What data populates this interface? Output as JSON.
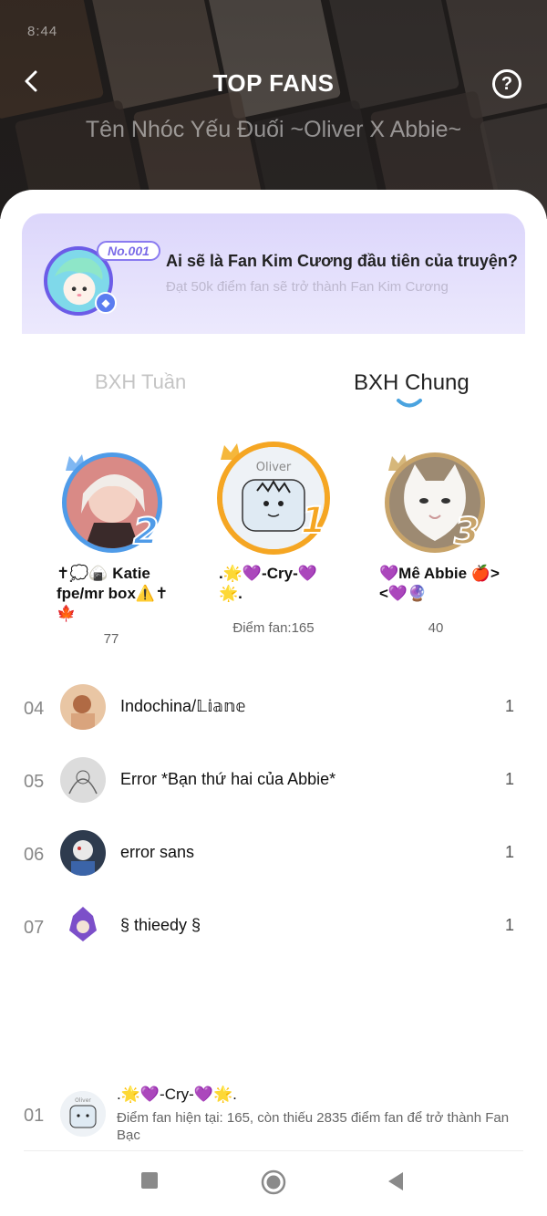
{
  "status_bar": {
    "time": "8:44",
    "right_text": ""
  },
  "header": {
    "title": "TOP FANS",
    "story_title": "Tên Nhóc Yếu Đuối ~Oliver X Abbie~"
  },
  "banner": {
    "badge": "No.001",
    "question": "Ai sẽ là Fan Kim Cương đầu tiên của truyện?",
    "subtitle": "Đạt 50k điểm fan sẽ trở thành Fan Kim Cương"
  },
  "tabs": [
    {
      "label": "BXH Tuần",
      "active": false
    },
    {
      "label": "BXH Chung",
      "active": true
    }
  ],
  "podium": [
    {
      "rank": "2",
      "name": "✝💭🍙 Katie fpe/mr box⚠️✝🍁",
      "score": "77",
      "ring_color": "#4f9be8"
    },
    {
      "rank": "1",
      "name": ".🌟💜-Cry-💜🌟.",
      "score": "Điểm fan:165",
      "ring_color": "#f5a623",
      "avatar_text": "Oliver"
    },
    {
      "rank": "3",
      "name": "💜Mê Abbie 🍎><💜🔮",
      "score": "40",
      "ring_color": "#c8a46a"
    }
  ],
  "list": [
    {
      "rank": "04",
      "name": "Indochina/𝕃𝕚𝕒𝕟𝕖",
      "score": "1"
    },
    {
      "rank": "05",
      "name": "Error *Bạn thứ hai của Abbie*",
      "score": "1"
    },
    {
      "rank": "06",
      "name": "error sans",
      "score": "1"
    },
    {
      "rank": "07",
      "name": "§ thieedy §",
      "score": "1"
    }
  ],
  "me": {
    "rank": "01",
    "name": ".🌟💜-Cry-💜🌟.",
    "desc": "Điểm fan hiện tại: 165, còn thiếu 2835 điểm fan để trở thành Fan Bạc",
    "avatar_text": "Oliver"
  },
  "colors": {
    "accent": "#4aa3df",
    "banner_bg": "#dcd6fb",
    "gold": "#f5a623",
    "silver_blue": "#4f9be8",
    "bronze": "#c8a46a"
  }
}
